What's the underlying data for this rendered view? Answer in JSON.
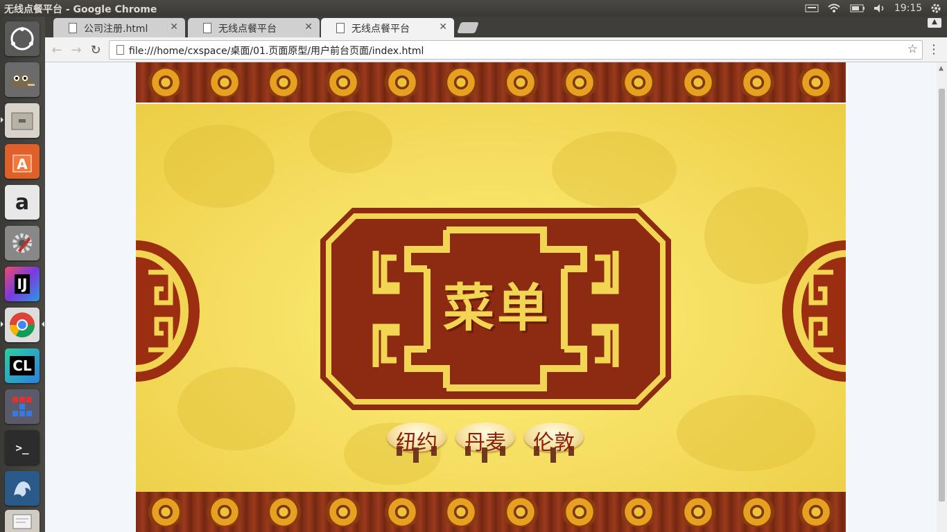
{
  "system_panel": {
    "window_title": "无线点餐平台 - Google Chrome",
    "clock": "19:15"
  },
  "launcher": {
    "items": [
      "dash-icon",
      "gimp-icon",
      "files-icon",
      "software-center-icon",
      "amazon-icon",
      "system-settings-icon",
      "intellij-icon",
      "chrome-icon",
      "clion-icon",
      "tetris-icon",
      "terminal-icon",
      "mysql-workbench-icon",
      "text-editor-icon"
    ],
    "intellij_label": "IJ",
    "clion_label": "CL",
    "amazon_label": "a",
    "terminal_label": ">_"
  },
  "browser": {
    "tabs": [
      {
        "label": "公司注册.html",
        "active": false
      },
      {
        "label": "无线点餐平台",
        "active": false
      },
      {
        "label": "无线点餐平台",
        "active": true
      }
    ],
    "url": "file:///home/cxspace/桌面/01.页面原型/用户前台页面/index.html"
  },
  "page": {
    "plaque_text": "菜单",
    "buttons": [
      {
        "label": "纽约"
      },
      {
        "label": "丹麦"
      },
      {
        "label": "伦敦"
      }
    ]
  },
  "colors": {
    "plaque_red": "#8c2a12",
    "plaque_gold": "#f2d653",
    "background_yellow": "#f6e064",
    "button_text": "#8a1f10"
  }
}
